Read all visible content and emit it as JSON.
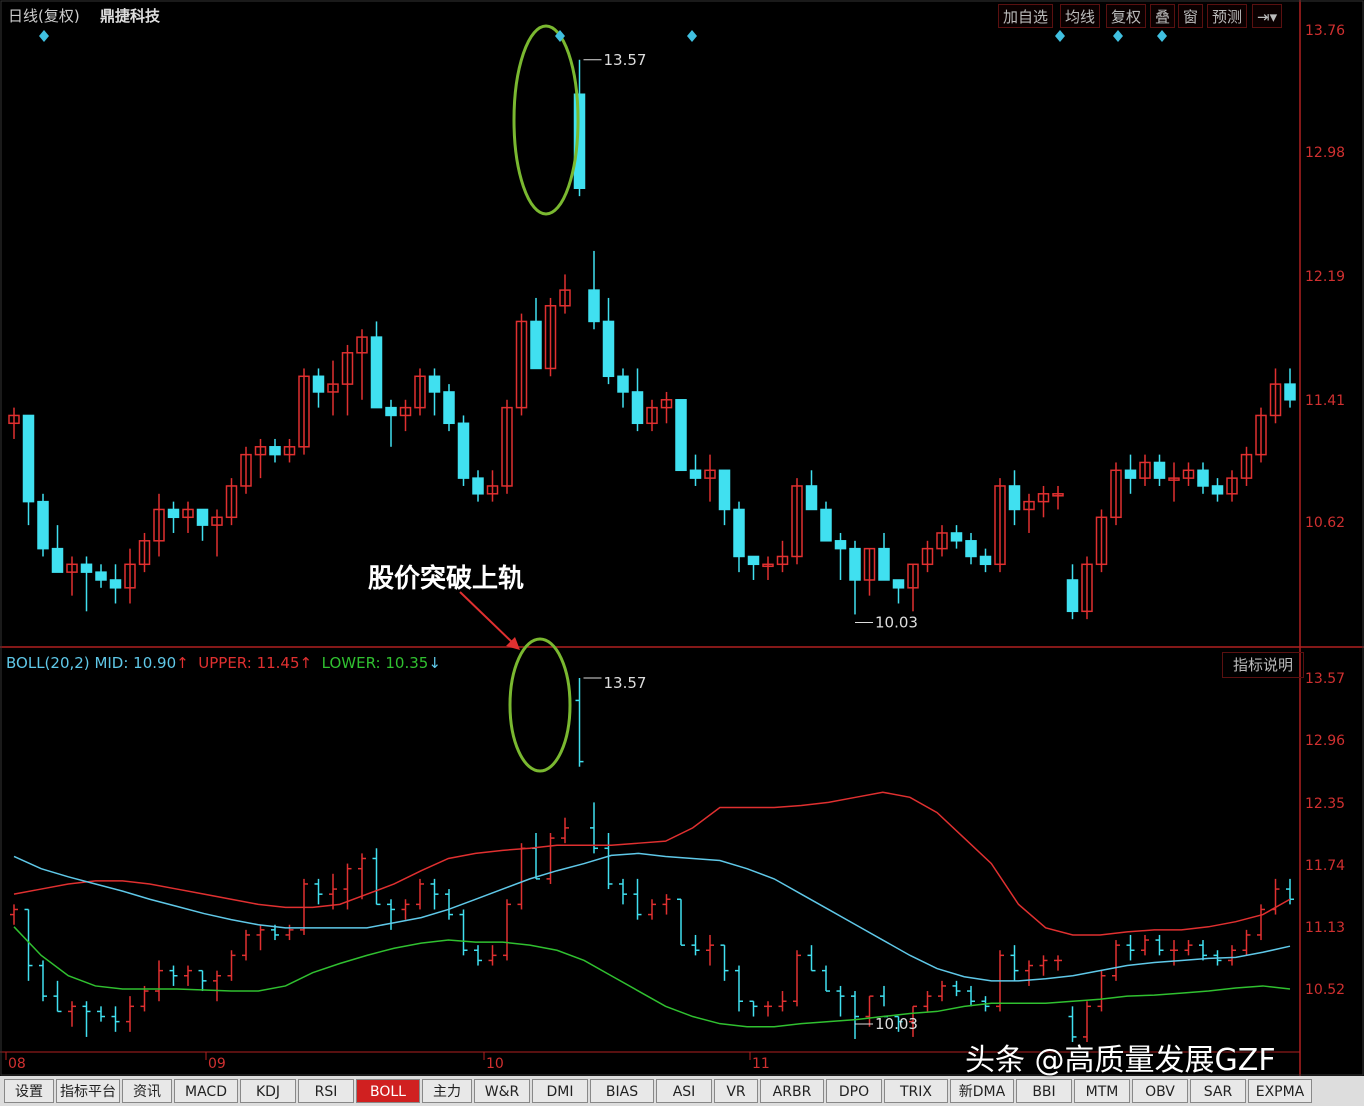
{
  "header": {
    "period": "日线(复权)",
    "stock_name": "鼎捷科技"
  },
  "toolbar": [
    {
      "label": "加自选"
    },
    {
      "label": "均线"
    },
    {
      "label": "复权"
    },
    {
      "label": "叠"
    },
    {
      "label": "窗"
    },
    {
      "label": "预测"
    },
    {
      "label": "⇥▾"
    }
  ],
  "main_axis_labels": [
    "13.76",
    "12.98",
    "12.19",
    "11.41",
    "10.62"
  ],
  "sub_axis_labels": [
    "13.57",
    "12.96",
    "12.35",
    "11.74",
    "11.13",
    "10.52"
  ],
  "x_axis_labels": [
    "08",
    "09",
    "10",
    "11"
  ],
  "annotation": "股价突破上轨",
  "max_label": "13.57",
  "min_label": "10.03",
  "boll": {
    "title": "BOLL(20,2)",
    "mid": "MID: 10.90",
    "upper": "UPPER: 11.45",
    "lower": "LOWER: 10.35",
    "mid_color": "#5fc8e8",
    "upper_color": "#e03030",
    "lower_color": "#30c030"
  },
  "indicator_help": "指标说明",
  "tabs": [
    "设置",
    "指标平台",
    "资讯",
    "MACD",
    "KDJ",
    "RSI",
    "BOLL",
    "主力",
    "W&R",
    "DMI",
    "BIAS",
    "ASI",
    "VR",
    "ARBR",
    "DPO",
    "TRIX",
    "新DMA",
    "BBI",
    "MTM",
    "OBV",
    "SAR",
    "EXPMA"
  ],
  "active_tab": "BOLL",
  "watermark": "头条 @高质量发展GZF",
  "colors": {
    "up": "#e03030",
    "down": "#40e0f0",
    "bg": "#000000",
    "axis": "#b02020"
  },
  "chart_data": {
    "type": "candlestick",
    "price_range": [
      10.03,
      13.57
    ],
    "max_price": 13.57,
    "min_price": 10.03,
    "candles": [
      [
        11.25,
        11.35,
        11.15,
        11.3
      ],
      [
        11.3,
        11.3,
        10.6,
        10.75
      ],
      [
        10.75,
        10.8,
        10.4,
        10.45
      ],
      [
        10.45,
        10.6,
        10.3,
        10.3
      ],
      [
        10.3,
        10.4,
        10.15,
        10.35
      ],
      [
        10.35,
        10.4,
        10.05,
        10.3
      ],
      [
        10.3,
        10.35,
        10.2,
        10.25
      ],
      [
        10.25,
        10.35,
        10.1,
        10.2
      ],
      [
        10.2,
        10.45,
        10.1,
        10.35
      ],
      [
        10.35,
        10.55,
        10.3,
        10.5
      ],
      [
        10.5,
        10.8,
        10.4,
        10.7
      ],
      [
        10.7,
        10.75,
        10.55,
        10.65
      ],
      [
        10.65,
        10.75,
        10.55,
        10.7
      ],
      [
        10.7,
        10.7,
        10.5,
        10.6
      ],
      [
        10.6,
        10.7,
        10.4,
        10.65
      ],
      [
        10.65,
        10.9,
        10.6,
        10.85
      ],
      [
        10.85,
        11.1,
        10.8,
        11.05
      ],
      [
        11.05,
        11.15,
        10.9,
        11.1
      ],
      [
        11.1,
        11.15,
        11.0,
        11.05
      ],
      [
        11.05,
        11.15,
        11.0,
        11.1
      ],
      [
        11.1,
        11.6,
        11.05,
        11.55
      ],
      [
        11.55,
        11.6,
        11.35,
        11.45
      ],
      [
        11.45,
        11.65,
        11.3,
        11.5
      ],
      [
        11.5,
        11.75,
        11.3,
        11.7
      ],
      [
        11.7,
        11.85,
        11.4,
        11.8
      ],
      [
        11.8,
        11.9,
        11.35,
        11.35
      ],
      [
        11.35,
        11.4,
        11.1,
        11.3
      ],
      [
        11.3,
        11.4,
        11.2,
        11.35
      ],
      [
        11.35,
        11.6,
        11.3,
        11.55
      ],
      [
        11.55,
        11.6,
        11.3,
        11.45
      ],
      [
        11.45,
        11.5,
        11.2,
        11.25
      ],
      [
        11.25,
        11.3,
        10.85,
        10.9
      ],
      [
        10.9,
        10.95,
        10.75,
        10.8
      ],
      [
        10.8,
        10.95,
        10.75,
        10.85
      ],
      [
        10.85,
        11.4,
        10.8,
        11.35
      ],
      [
        11.35,
        11.95,
        11.3,
        11.9
      ],
      [
        11.9,
        12.05,
        11.6,
        11.6
      ],
      [
        11.6,
        12.05,
        11.55,
        12.0
      ],
      [
        12.0,
        12.2,
        11.95,
        12.1
      ],
      [
        13.35,
        13.57,
        12.7,
        12.75
      ],
      [
        12.1,
        12.35,
        11.85,
        11.9
      ],
      [
        11.9,
        12.05,
        11.5,
        11.55
      ],
      [
        11.55,
        11.6,
        11.35,
        11.45
      ],
      [
        11.45,
        11.6,
        11.2,
        11.25
      ],
      [
        11.25,
        11.4,
        11.2,
        11.35
      ],
      [
        11.35,
        11.45,
        11.25,
        11.4
      ],
      [
        11.4,
        11.4,
        10.95,
        10.95
      ],
      [
        10.95,
        11.05,
        10.85,
        10.9
      ],
      [
        10.9,
        11.05,
        10.75,
        10.95
      ],
      [
        10.95,
        10.95,
        10.6,
        10.7
      ],
      [
        10.7,
        10.75,
        10.3,
        10.4
      ],
      [
        10.4,
        10.4,
        10.25,
        10.35
      ],
      [
        10.35,
        10.4,
        10.25,
        10.35
      ],
      [
        10.35,
        10.5,
        10.3,
        10.4
      ],
      [
        10.4,
        10.9,
        10.35,
        10.85
      ],
      [
        10.85,
        10.95,
        10.7,
        10.7
      ],
      [
        10.7,
        10.75,
        10.5,
        10.5
      ],
      [
        10.5,
        10.55,
        10.25,
        10.45
      ],
      [
        10.45,
        10.5,
        10.03,
        10.25
      ],
      [
        10.25,
        10.45,
        10.15,
        10.45
      ],
      [
        10.45,
        10.55,
        10.35,
        10.25
      ],
      [
        10.25,
        10.25,
        10.1,
        10.2
      ],
      [
        10.2,
        10.35,
        10.05,
        10.35
      ],
      [
        10.35,
        10.5,
        10.3,
        10.45
      ],
      [
        10.45,
        10.6,
        10.4,
        10.55
      ],
      [
        10.55,
        10.6,
        10.45,
        10.5
      ],
      [
        10.5,
        10.55,
        10.35,
        10.4
      ],
      [
        10.4,
        10.45,
        10.3,
        10.35
      ],
      [
        10.35,
        10.9,
        10.3,
        10.85
      ],
      [
        10.85,
        10.95,
        10.6,
        10.7
      ],
      [
        10.7,
        10.8,
        10.55,
        10.75
      ],
      [
        10.75,
        10.85,
        10.65,
        10.8
      ],
      [
        10.8,
        10.85,
        10.7,
        10.8
      ],
      [
        10.25,
        10.35,
        10.0,
        10.05
      ],
      [
        10.05,
        10.4,
        10.0,
        10.35
      ],
      [
        10.35,
        10.7,
        10.3,
        10.65
      ],
      [
        10.65,
        11.0,
        10.6,
        10.95
      ],
      [
        10.95,
        11.05,
        10.8,
        10.9
      ],
      [
        10.9,
        11.05,
        10.85,
        11.0
      ],
      [
        11.0,
        11.05,
        10.85,
        10.9
      ],
      [
        10.9,
        11.0,
        10.75,
        10.9
      ],
      [
        10.9,
        11.0,
        10.85,
        10.95
      ],
      [
        10.95,
        11.0,
        10.8,
        10.85
      ],
      [
        10.85,
        10.9,
        10.75,
        10.8
      ],
      [
        10.8,
        10.95,
        10.75,
        10.9
      ],
      [
        10.9,
        11.1,
        10.85,
        11.05
      ],
      [
        11.05,
        11.35,
        11.0,
        11.3
      ],
      [
        11.3,
        11.6,
        11.25,
        11.5
      ],
      [
        11.5,
        11.6,
        11.35,
        11.4
      ]
    ],
    "boll_upper": [
      11.45,
      11.5,
      11.55,
      11.58,
      11.58,
      11.55,
      11.5,
      11.45,
      11.4,
      11.35,
      11.32,
      11.32,
      11.35,
      11.45,
      11.55,
      11.68,
      11.8,
      11.85,
      11.88,
      11.9,
      11.93,
      11.93,
      11.93,
      11.95,
      11.97,
      12.1,
      12.3,
      12.3,
      12.3,
      12.32,
      12.35,
      12.4,
      12.45,
      12.4,
      12.25,
      12.0,
      11.75,
      11.35,
      11.12,
      11.05,
      11.05,
      11.08,
      11.1,
      11.1,
      11.13,
      11.18,
      11.25,
      11.4
    ],
    "boll_mid": [
      11.82,
      11.7,
      11.62,
      11.55,
      11.48,
      11.4,
      11.33,
      11.26,
      11.2,
      11.15,
      11.12,
      11.12,
      11.12,
      11.12,
      11.17,
      11.22,
      11.3,
      11.4,
      11.5,
      11.6,
      11.68,
      11.75,
      11.83,
      11.85,
      11.82,
      11.8,
      11.78,
      11.7,
      11.6,
      11.45,
      11.3,
      11.15,
      11.0,
      10.85,
      10.72,
      10.64,
      10.6,
      10.6,
      10.62,
      10.65,
      10.7,
      10.75,
      10.78,
      10.8,
      10.82,
      10.83,
      10.88,
      10.94
    ],
    "boll_lower": [
      11.13,
      10.85,
      10.65,
      10.55,
      10.52,
      10.52,
      10.52,
      10.51,
      10.5,
      10.5,
      10.55,
      10.68,
      10.77,
      10.85,
      10.92,
      10.97,
      11.0,
      10.98,
      10.98,
      10.95,
      10.9,
      10.8,
      10.65,
      10.5,
      10.35,
      10.25,
      10.18,
      10.15,
      10.15,
      10.18,
      10.2,
      10.22,
      10.25,
      10.28,
      10.3,
      10.35,
      10.38,
      10.38,
      10.38,
      10.4,
      10.42,
      10.45,
      10.46,
      10.48,
      10.5,
      10.53,
      10.55,
      10.52
    ]
  }
}
